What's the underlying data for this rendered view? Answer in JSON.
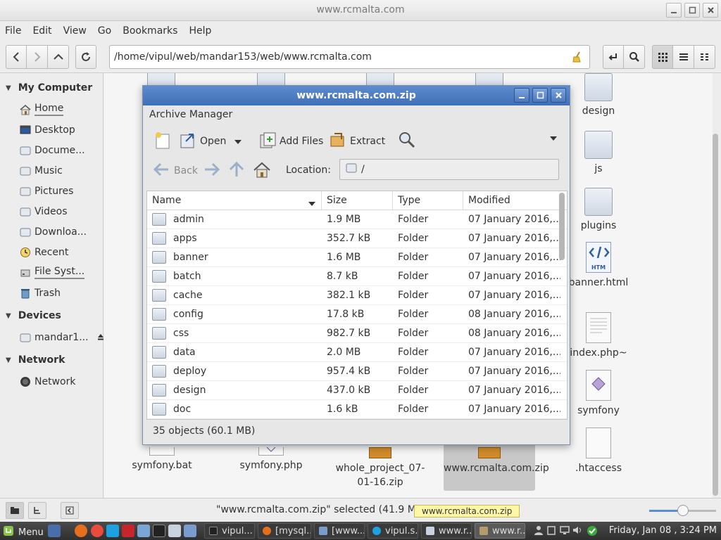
{
  "window": {
    "title": "www.rcmalta.com"
  },
  "menubar": [
    "File",
    "Edit",
    "View",
    "Go",
    "Bookmarks",
    "Help"
  ],
  "path": "/home/vipul/web/mandar153/web/www.rcmalta.com",
  "sidebar": {
    "sections": [
      {
        "title": "My Computer",
        "items": [
          {
            "label": "Home",
            "icon": "home-icon"
          },
          {
            "label": "Desktop",
            "icon": "desktop-icon"
          },
          {
            "label": "Docume...",
            "icon": "folder-icon"
          },
          {
            "label": "Music",
            "icon": "folder-icon"
          },
          {
            "label": "Pictures",
            "icon": "folder-icon"
          },
          {
            "label": "Videos",
            "icon": "folder-icon"
          },
          {
            "label": "Downloa...",
            "icon": "folder-icon"
          },
          {
            "label": "Recent",
            "icon": "recent-icon"
          },
          {
            "label": "File Syst...",
            "icon": "drive-icon"
          },
          {
            "label": "Trash",
            "icon": "trash-icon"
          }
        ]
      },
      {
        "title": "Devices",
        "items": [
          {
            "label": "mandar1...",
            "icon": "folder-icon"
          }
        ]
      },
      {
        "title": "Network",
        "items": [
          {
            "label": "Network",
            "icon": "network-icon"
          }
        ]
      }
    ]
  },
  "files_right": [
    "design",
    "js",
    "plugins",
    "banner.html",
    "index.php~",
    "symfony",
    ".htaccess"
  ],
  "files_bottom": [
    "symfony.bat",
    "symfony.php",
    "whole_project_07-01-16.zip",
    "www.rcmalta.com.zip"
  ],
  "htm_label": "HTM",
  "status": {
    "text": "\"www.rcmalta.com.zip\" selected (41.9 MB)",
    "tooltip": "www.rcmalta.com.zip",
    "zoom_fraction": 0.5
  },
  "archive": {
    "title": "www.rcmalta.com.zip",
    "menu": "Archive Manager",
    "toolbar": {
      "open": "Open",
      "add_files": "Add Files",
      "extract": "Extract"
    },
    "nav": {
      "back": "Back",
      "location_label": "Location:",
      "location_value": "/"
    },
    "columns": [
      "Name",
      "Size",
      "Type",
      "Modified"
    ],
    "rows": [
      {
        "name": "admin",
        "size": "1.9 MB",
        "type": "Folder",
        "modified": "07 January 2016,..."
      },
      {
        "name": "apps",
        "size": "352.7 kB",
        "type": "Folder",
        "modified": "07 January 2016,..."
      },
      {
        "name": "banner",
        "size": "1.6 MB",
        "type": "Folder",
        "modified": "07 January 2016,..."
      },
      {
        "name": "batch",
        "size": "8.7 kB",
        "type": "Folder",
        "modified": "07 January 2016,..."
      },
      {
        "name": "cache",
        "size": "382.1 kB",
        "type": "Folder",
        "modified": "07 January 2016,..."
      },
      {
        "name": "config",
        "size": "17.8 kB",
        "type": "Folder",
        "modified": "08 January 2016,..."
      },
      {
        "name": "css",
        "size": "982.7 kB",
        "type": "Folder",
        "modified": "08 January 2016,..."
      },
      {
        "name": "data",
        "size": "2.0 MB",
        "type": "Folder",
        "modified": "07 January 2016,..."
      },
      {
        "name": "deploy",
        "size": "957.4 kB",
        "type": "Folder",
        "modified": "07 January 2016,..."
      },
      {
        "name": "design",
        "size": "437.0 kB",
        "type": "Folder",
        "modified": "07 January 2016,..."
      },
      {
        "name": "doc",
        "size": "1.6 kB",
        "type": "Folder",
        "modified": "07 January 2016,..."
      }
    ],
    "status": "35 objects (60.1 MB)"
  },
  "taskbar": {
    "menu": "Menu",
    "tasks": [
      "vipul...",
      "[mysql...",
      "[www....",
      "vipul.s...",
      "www.r...",
      "www.r..."
    ],
    "clock": "Friday, Jan 08 , 3:24 PM"
  }
}
